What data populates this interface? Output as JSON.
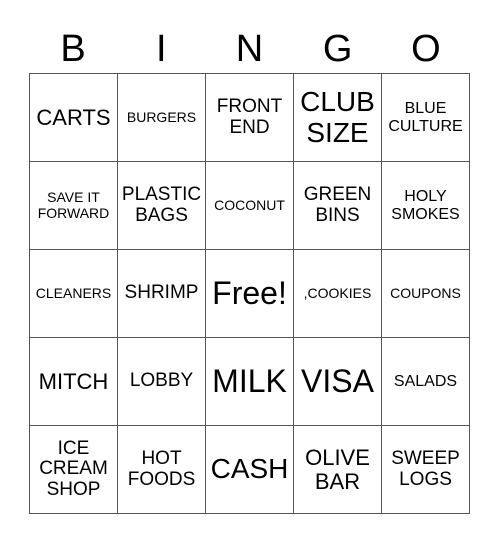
{
  "header": {
    "letters": [
      "B",
      "I",
      "N",
      "G",
      "O"
    ]
  },
  "card": {
    "rows": [
      [
        "CARTS",
        "BURGERS",
        "FRONT\nEND",
        "CLUB\nSIZE",
        "BLUE\nCULTURE"
      ],
      [
        "SAVE IT\nFORWARD",
        "PLASTIC\nBAGS",
        "COCONUT",
        "GREEN\nBINS",
        "HOLY\nSMOKES"
      ],
      [
        "CLEANERS",
        "SHRIMP",
        "Free!",
        ",COOKIES",
        "COUPONS"
      ],
      [
        "MITCH",
        "LOBBY",
        "MILK",
        "VISA",
        "SALADS"
      ],
      [
        "ICE\nCREAM\nSHOP",
        "HOT\nFOODS",
        "CASH",
        "OLIVE\nBAR",
        "SWEEP\nLOGS"
      ]
    ]
  }
}
